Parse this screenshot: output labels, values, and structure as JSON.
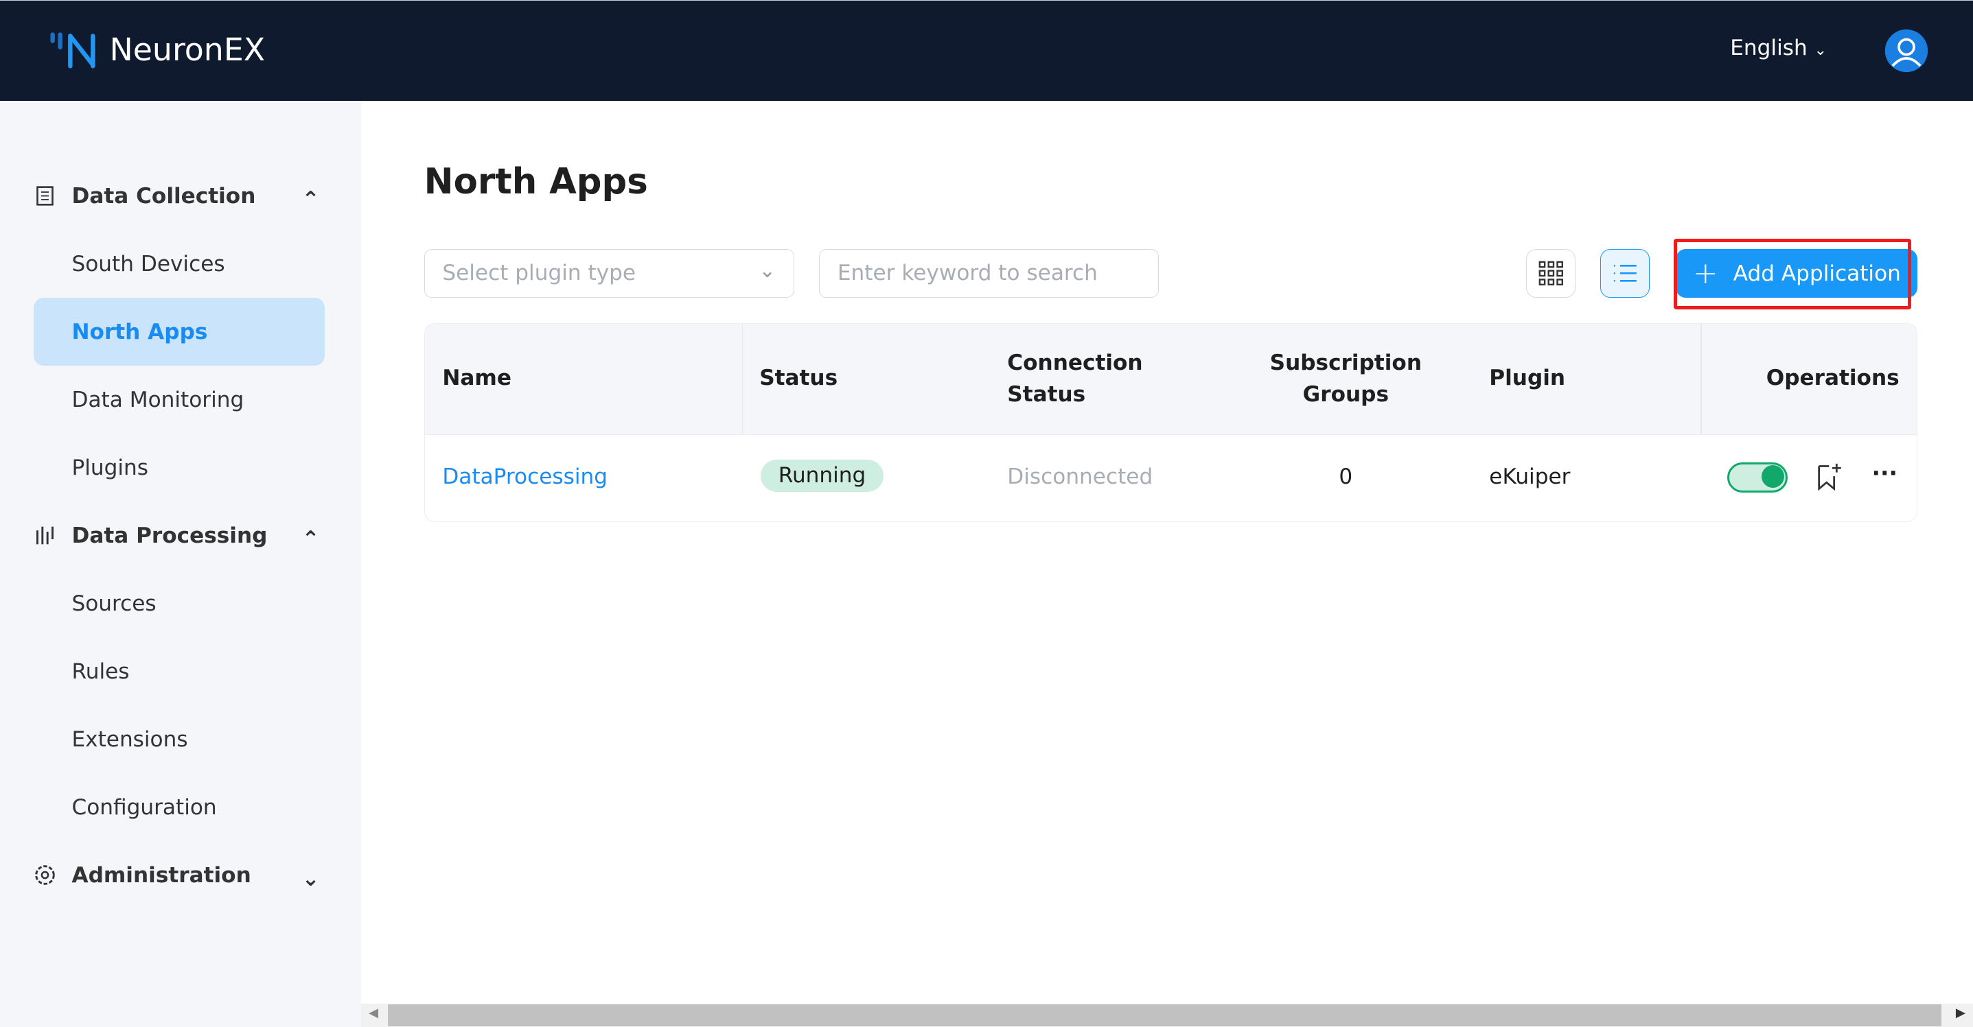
{
  "header": {
    "brand": "NeuronEX",
    "language": "English",
    "avatar_icon": "user-icon",
    "bg_color": "#0f1a2e"
  },
  "sidebar": {
    "groups": [
      {
        "label": "Data Collection",
        "icon": "data-collection-icon",
        "expanded": true,
        "items": [
          "South Devices",
          "North Apps",
          "Data Monitoring",
          "Plugins"
        ]
      },
      {
        "label": "Data Processing",
        "icon": "data-processing-icon",
        "expanded": true,
        "items": [
          "Sources",
          "Rules",
          "Extensions",
          "Configuration"
        ]
      },
      {
        "label": "Administration",
        "icon": "gear-icon",
        "expanded": false,
        "items": []
      }
    ],
    "selected": "North Apps"
  },
  "main": {
    "title": "North Apps",
    "plugin_select_placeholder": "Select plugin type",
    "search_placeholder": "Enter keyword to search",
    "add_button": "Add Application",
    "view_mode": "list",
    "accent_color": "#1a98f7",
    "table": {
      "columns": [
        "Name",
        "Status",
        "Connection\nStatus",
        "Subscription\nGroups",
        "Plugin",
        "Operations"
      ],
      "rows": [
        {
          "name": "DataProcessing",
          "status": "Running",
          "connection": "Disconnected",
          "groups": "0",
          "plugin": "eKuiper",
          "enabled": true
        }
      ]
    }
  }
}
